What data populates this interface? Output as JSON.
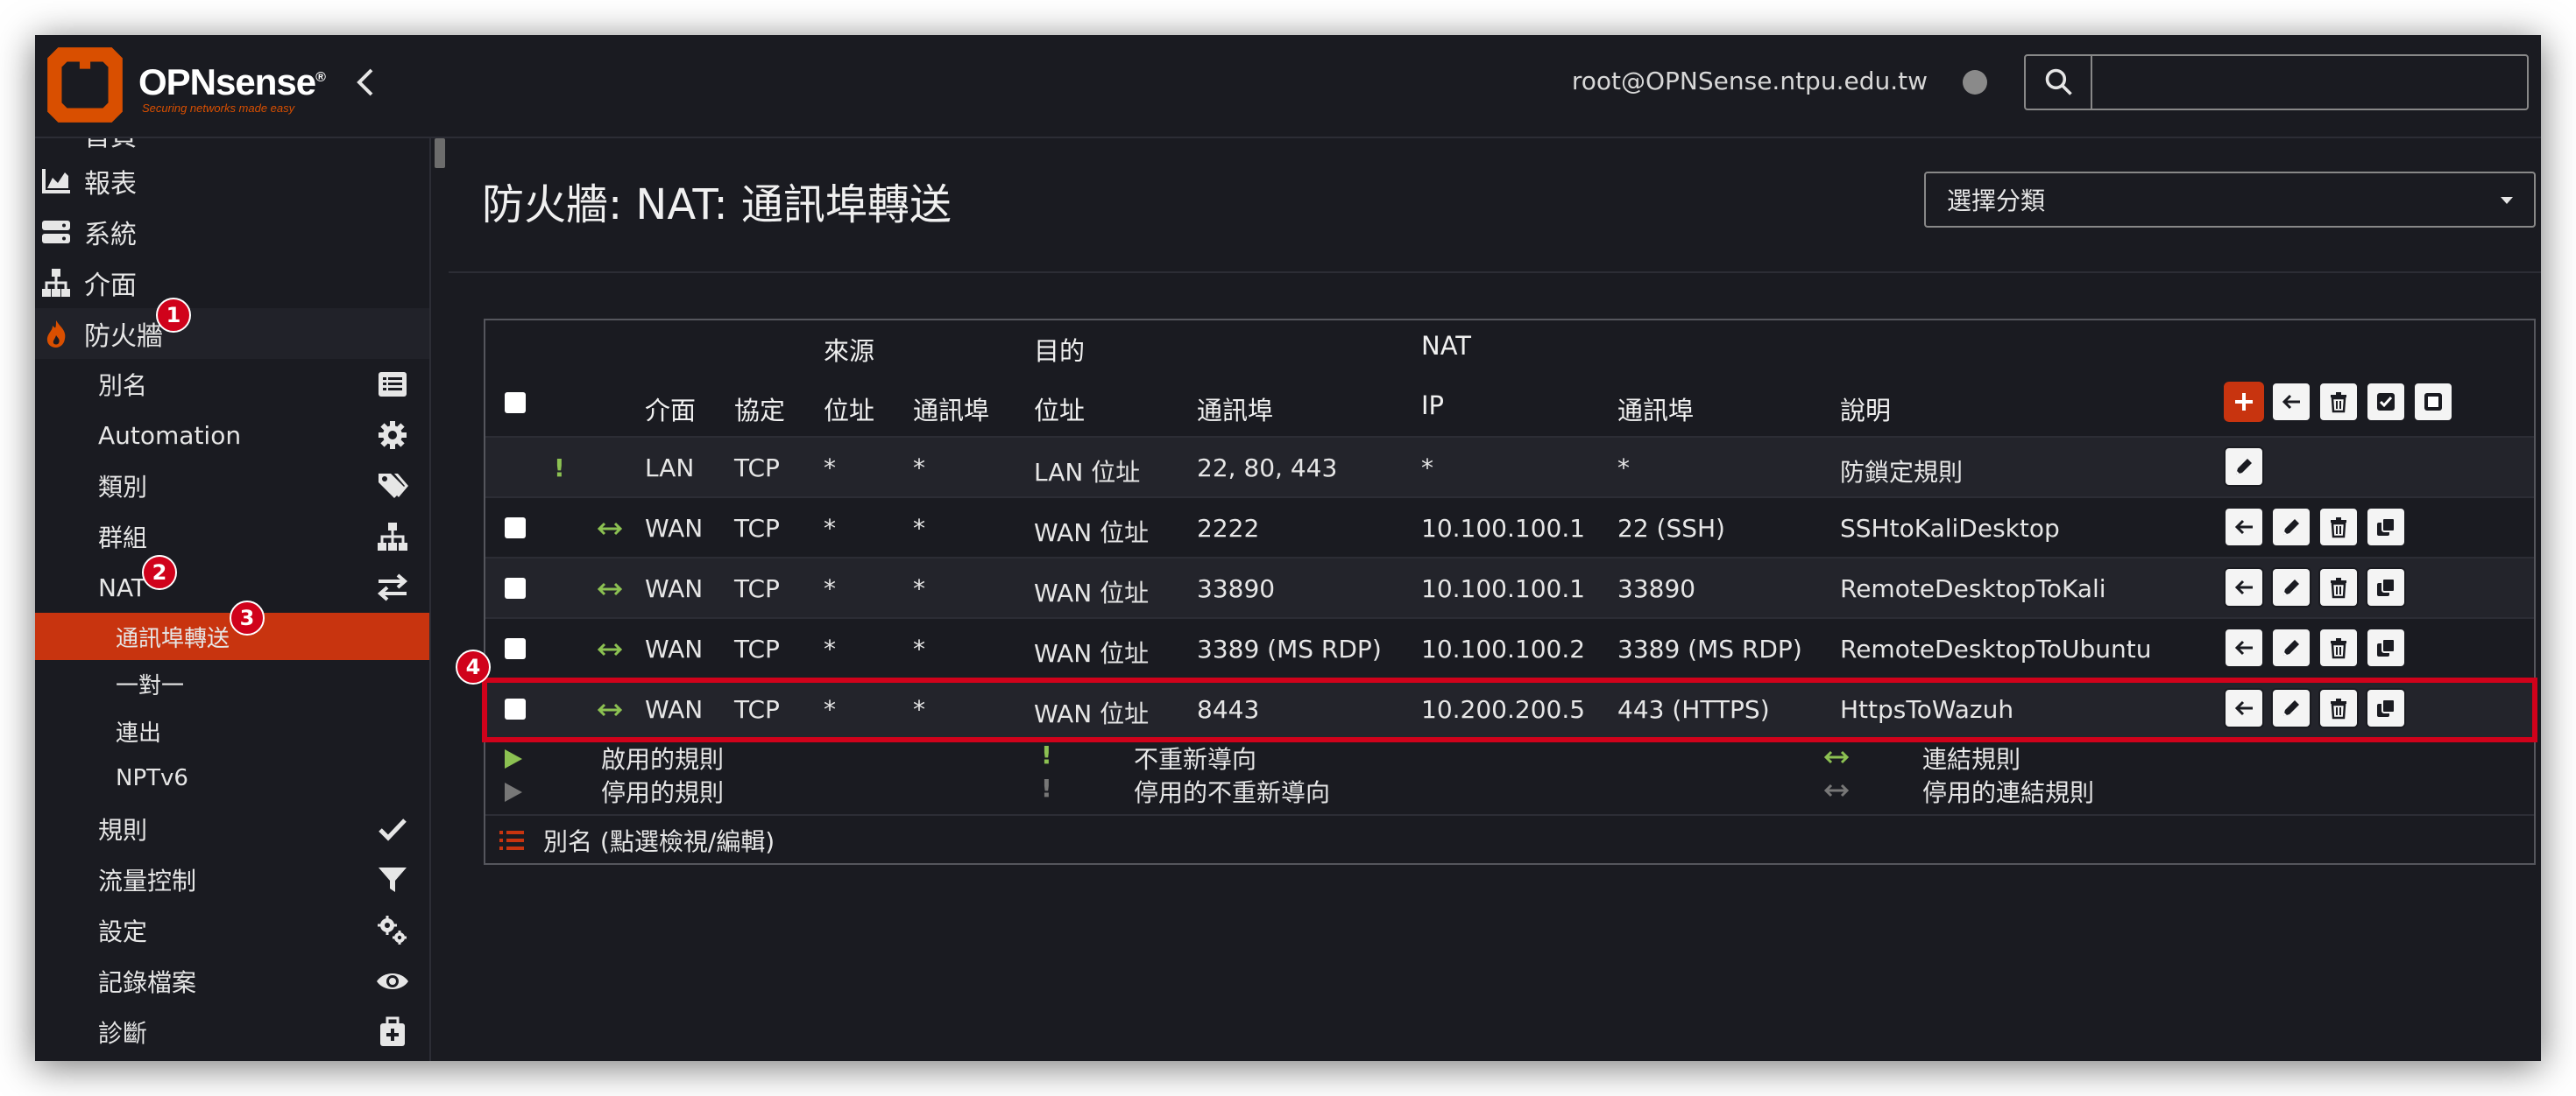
{
  "header": {
    "brand": "OPNsense",
    "brand_mark": "®",
    "tagline": "Securing networks made easy",
    "user": "root@OPNSense.ntpu.edu.tw",
    "search_placeholder": ""
  },
  "sidebar": {
    "items": [
      {
        "label": "首頁",
        "icon": "home-icon"
      },
      {
        "label": "報表",
        "icon": "chart-icon"
      },
      {
        "label": "系統",
        "icon": "server-icon"
      },
      {
        "label": "介面",
        "icon": "network-icon"
      },
      {
        "label": "防火牆",
        "icon": "fire-icon",
        "badge": "1"
      }
    ],
    "firewall_sub": [
      {
        "label": "別名",
        "icon": "list-icon"
      },
      {
        "label": "Automation",
        "icon": "gear-icon"
      },
      {
        "label": "類別",
        "icon": "tags-icon"
      },
      {
        "label": "群組",
        "icon": "sitemap-icon"
      },
      {
        "label": "NAT",
        "icon": "exchange-icon",
        "badge": "2"
      }
    ],
    "nat_sub": [
      {
        "label": "通訊埠轉送",
        "badge": "3",
        "active": true
      },
      {
        "label": "一對一"
      },
      {
        "label": "連出"
      },
      {
        "label": "NPTv6"
      }
    ],
    "firewall_sub2": [
      {
        "label": "規則",
        "icon": "check-icon"
      },
      {
        "label": "流量控制",
        "icon": "filter-icon"
      },
      {
        "label": "設定",
        "icon": "gears-icon"
      },
      {
        "label": "記錄檔案",
        "icon": "eye-icon"
      },
      {
        "label": "診斷",
        "icon": "medkit-icon"
      }
    ]
  },
  "main": {
    "title": "防火牆: NAT: 通訊埠轉送",
    "category_select": "選擇分類",
    "group_headers": {
      "source": "來源",
      "destination": "目的",
      "nat": "NAT"
    },
    "columns": {
      "iface": "介面",
      "proto": "協定",
      "src_addr": "位址",
      "src_port": "通訊埠",
      "dst_addr": "位址",
      "dst_port": "通訊埠",
      "nat_ip": "IP",
      "nat_port": "通訊埠",
      "descr": "說明"
    },
    "rows": [
      {
        "iface": "LAN",
        "proto": "TCP",
        "src_addr": "*",
        "src_port": "*",
        "dst_addr": "LAN 位址",
        "dst_port": "22, 80, 443",
        "nat_ip": "*",
        "nat_port": "*",
        "descr": "防鎖定規則",
        "type": "anti-lockout"
      },
      {
        "iface": "WAN",
        "proto": "TCP",
        "src_addr": "*",
        "src_port": "*",
        "dst_addr": "WAN 位址",
        "dst_port": "2222",
        "nat_ip": "10.100.100.1",
        "nat_port": "22 (SSH)",
        "descr": "SSHtoKaliDesktop",
        "type": "rule"
      },
      {
        "iface": "WAN",
        "proto": "TCP",
        "src_addr": "*",
        "src_port": "*",
        "dst_addr": "WAN 位址",
        "dst_port": "33890",
        "nat_ip": "10.100.100.1",
        "nat_port": "33890",
        "descr": "RemoteDesktopToKali",
        "type": "rule"
      },
      {
        "iface": "WAN",
        "proto": "TCP",
        "src_addr": "*",
        "src_port": "*",
        "dst_addr": "WAN 位址",
        "dst_port": "3389 (MS RDP)",
        "nat_ip": "10.100.100.2",
        "nat_port": "3389 (MS RDP)",
        "descr": "RemoteDesktopToUbuntu",
        "type": "rule"
      },
      {
        "iface": "WAN",
        "proto": "TCP",
        "src_addr": "*",
        "src_port": "*",
        "dst_addr": "WAN 位址",
        "dst_port": "8443",
        "nat_ip": "10.200.200.5",
        "nat_port": "443 (HTTPS)",
        "descr": "HttpsToWazuh",
        "type": "rule",
        "badge": "4"
      }
    ],
    "legend": {
      "enabled": "啟用的規則",
      "disabled": "停用的規則",
      "no_redirect": "不重新導向",
      "disabled_no_redirect": "停用的不重新導向",
      "linked": "連結規則",
      "disabled_linked": "停用的連結規則",
      "alias": "別名 (點選檢視/編輯)"
    }
  },
  "colors": {
    "accent": "#c8340f",
    "green": "#8cc152",
    "badge": "#d0021b",
    "bg": "#1a1b21"
  }
}
